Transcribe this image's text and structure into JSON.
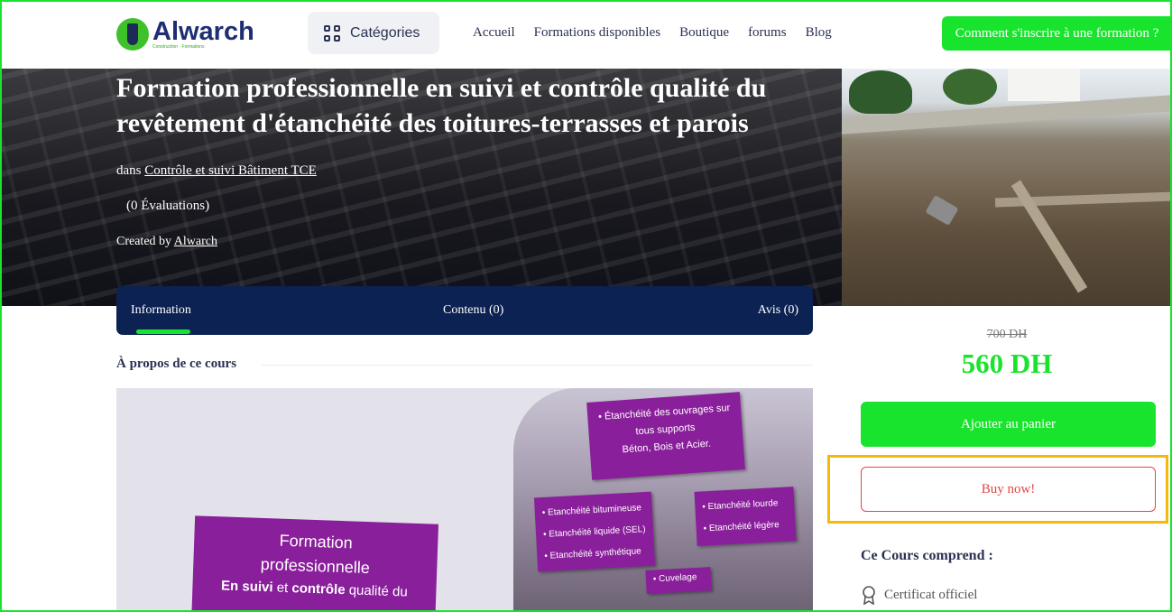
{
  "header": {
    "logo_name": "Alwarch",
    "logo_tagline": "Construction · Formations",
    "categories_label": "Catégories",
    "nav": [
      "Accueil",
      "Formations disponibles",
      "Boutique",
      "forums",
      "Blog"
    ],
    "cta_label": "Comment s'inscrire à une formation ?"
  },
  "course": {
    "title": "Formation professionnelle en suivi et contrôle qualité du revêtement d'étanchéité des toitures-terrasses et parois",
    "category_prefix": "dans",
    "category": "Contrôle et suivi Bâtiment TCE",
    "rating_text": "(0 Évaluations)",
    "author_prefix": "Created by",
    "author": "Alwarch"
  },
  "tabs": {
    "information": "Information",
    "contenu": "Contenu (0)",
    "avis": "Avis (0)"
  },
  "about_heading": "À propos de ce cours",
  "course_image": {
    "box1_line1": "• Étanchéité des ouvrages sur",
    "box1_line2": "tous supports",
    "box1_line3": "Béton, Bois et Acier.",
    "box2_items": [
      "• Etanchéité bitumineuse",
      "• Etanchéité liquide (SEL)",
      "• Etanchéité synthétique"
    ],
    "box3_items": [
      "• Etanchéité lourde",
      "• Etanchéité légère"
    ],
    "box4_item": "• Cuvelage",
    "card_line1": "Formation",
    "card_line2": "professionnelle",
    "card_line3_bold1": "En suivi",
    "card_line3_mid": " et ",
    "card_line3_bold2": "contrôle",
    "card_line3_end": " qualité du"
  },
  "pricing": {
    "old_price": "700 DH",
    "new_price": "560 DH",
    "add_to_cart": "Ajouter au panier",
    "buy_now": "Buy now!"
  },
  "includes": {
    "heading": "Ce Cours comprend :",
    "items": [
      "Certificat officiel"
    ]
  },
  "colors": {
    "accent": "#19e42d",
    "navy": "#0c2253",
    "danger": "#e24648",
    "highlight": "#f6b90b",
    "purple": "#8a1f9b"
  }
}
